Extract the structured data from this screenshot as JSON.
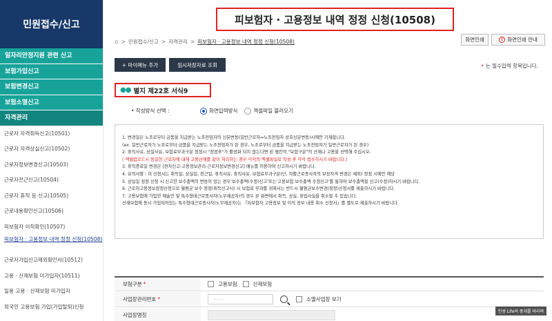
{
  "sidebar": {
    "title": "민원접수/신고",
    "categories": [
      {
        "label": "일자리안정지원 관련 신고"
      },
      {
        "label": "보험가입신고"
      },
      {
        "label": "보험변경신고"
      },
      {
        "label": "보험소멸신고"
      },
      {
        "label": "자격관리"
      }
    ],
    "items": [
      {
        "label": "근로자 자격취득신고(10501)"
      },
      {
        "label": "근로자 자격상실신고(10502)"
      },
      {
        "label": "근로자정보변경신고(10503)"
      },
      {
        "label": "근로자전근신고(10504)"
      },
      {
        "label": "근로자 휴직 등 신고(10505)"
      },
      {
        "label": "근로내용확인신고(10506)"
      },
      {
        "label": "피보험자 이직확인(10507)"
      },
      {
        "label": "피보험자 · 고용정보 내역 정정 신청(10508)"
      },
      {
        "label": "근로자가입신고제외확인서(10512)"
      },
      {
        "label": "고용 · 산재보험 미가입자(10511)"
      },
      {
        "label": "일용 고용 · 산재보험 미가입자"
      },
      {
        "label": "외국인 고용보험 가입(가입탈퇴)신청"
      }
    ]
  },
  "header": {
    "title": "피보험자 · 고용정보 내역 정정 신청(10508)",
    "breadcrumb": [
      "민원접수/신고",
      "자격관리",
      "피보험자 · 고용정보 내역 정정 신청(10508)"
    ],
    "print_label": "화면인쇄",
    "print_guide_label": "화면인쇄 안내"
  },
  "toolbar": {
    "add_menu_label": "+ 마이메뉴 추가",
    "temp_save_label": "임시저장자료 조회",
    "required_note": "는 필수입력 항목입니다."
  },
  "form_label": "별지 제22호 서식9",
  "input_method": {
    "label": "작성방식 선택 :",
    "options": [
      "화면입력방식",
      "엑셀파일 불러오기"
    ],
    "selected": "화면입력방식"
  },
  "notes": [
    {
      "text": "1. 변경일은 노조로부터 금품을 지급받는 노조전임자의 신분변동(일반근로자↔노조전임자 상호신분변동)시에만 기재합니다.",
      "red": false
    },
    {
      "text": "   (ex. 일반근로자가 노조로부터 금품을 지급받는 노조전임자가 된 경우, 노조로부터 금품을 지급받는 노조전임자가 일반근로자가 된 경우)",
      "red": false
    },
    {
      "text": "2. 휴직사유, 상실사유, 보험료부과구분 정정시 \"정정후\"가 활성화 되지 않는다면 왼 옆칸의 \"보험구분\"의 산재나 고용을 선택해 주십시오.",
      "red": false
    },
    {
      "text": "   ( 엑셀업로드시 동일한 근로자에 대해 고용산재를 같이 처리하는 경우 각각의 엑셀파일로 작성 후 각각 접수하시기 바랍니다.)",
      "red": true
    },
    {
      "text": "3. 휴직종료일 변경은 [전자신고-고용정보관리-근로자정보변경신고] 메뉴를 이용하여 신고하시기 바랍니다.",
      "red": false
    },
    {
      "text": "4. 유의사항 : 이 신청서는 취득일, 상실일, 전근일, 휴직사유, 휴직사유, 보험료부과구분(단, 자활근로종사자의 보장자격 변경은 제외) 정정 시에만 해당",
      "red": false
    },
    {
      "text": "5. 상실일 정정 신청 시 신고한 보수총액의 변동이 있는 경우'보수총액(수정)신고'또는'고용보험 보수총액 수정신고'를 통하여 보수총액을 신고(수정)하시기 바랍니다.",
      "red": false
    },
    {
      "text": "6. 근로자고용정보정정신청으로 월평균 보수 정정(취득신고시) 시 보험료 부과를 위해서는 반드시 월평균보수변경(정정)신청서를 제출하시기 바랍니다.",
      "red": false
    },
    {
      "text": "7. 고용보험에 가입한 예술인 및 특수형태근로종사자(노무제공자)의 경우 본 화면에서 취득, 상실, 휴업사실을 취소할 수 있습니다.",
      "red": false
    },
    {
      "text": "   산재보험에 동시 가입되어있는 특수형태근로종사자(노무제공자)는 「피보험자 고용정보 및 이직 정보 내용 취소 신청서」를 별도로 제출하시기 바랍니다.",
      "red": false
    }
  ],
  "fields": {
    "insurance_type": {
      "label": "보험구분",
      "options": [
        "고용보험",
        "산재보험"
      ]
    },
    "business_no": {
      "label": "사업장관리번호",
      "placeholder": "- - -",
      "small_biz_label": "소멸사업장 보기"
    },
    "business_name": {
      "label": "사업장명칭"
    }
  },
  "watermark": "인생 Life의 중개를 바라며"
}
